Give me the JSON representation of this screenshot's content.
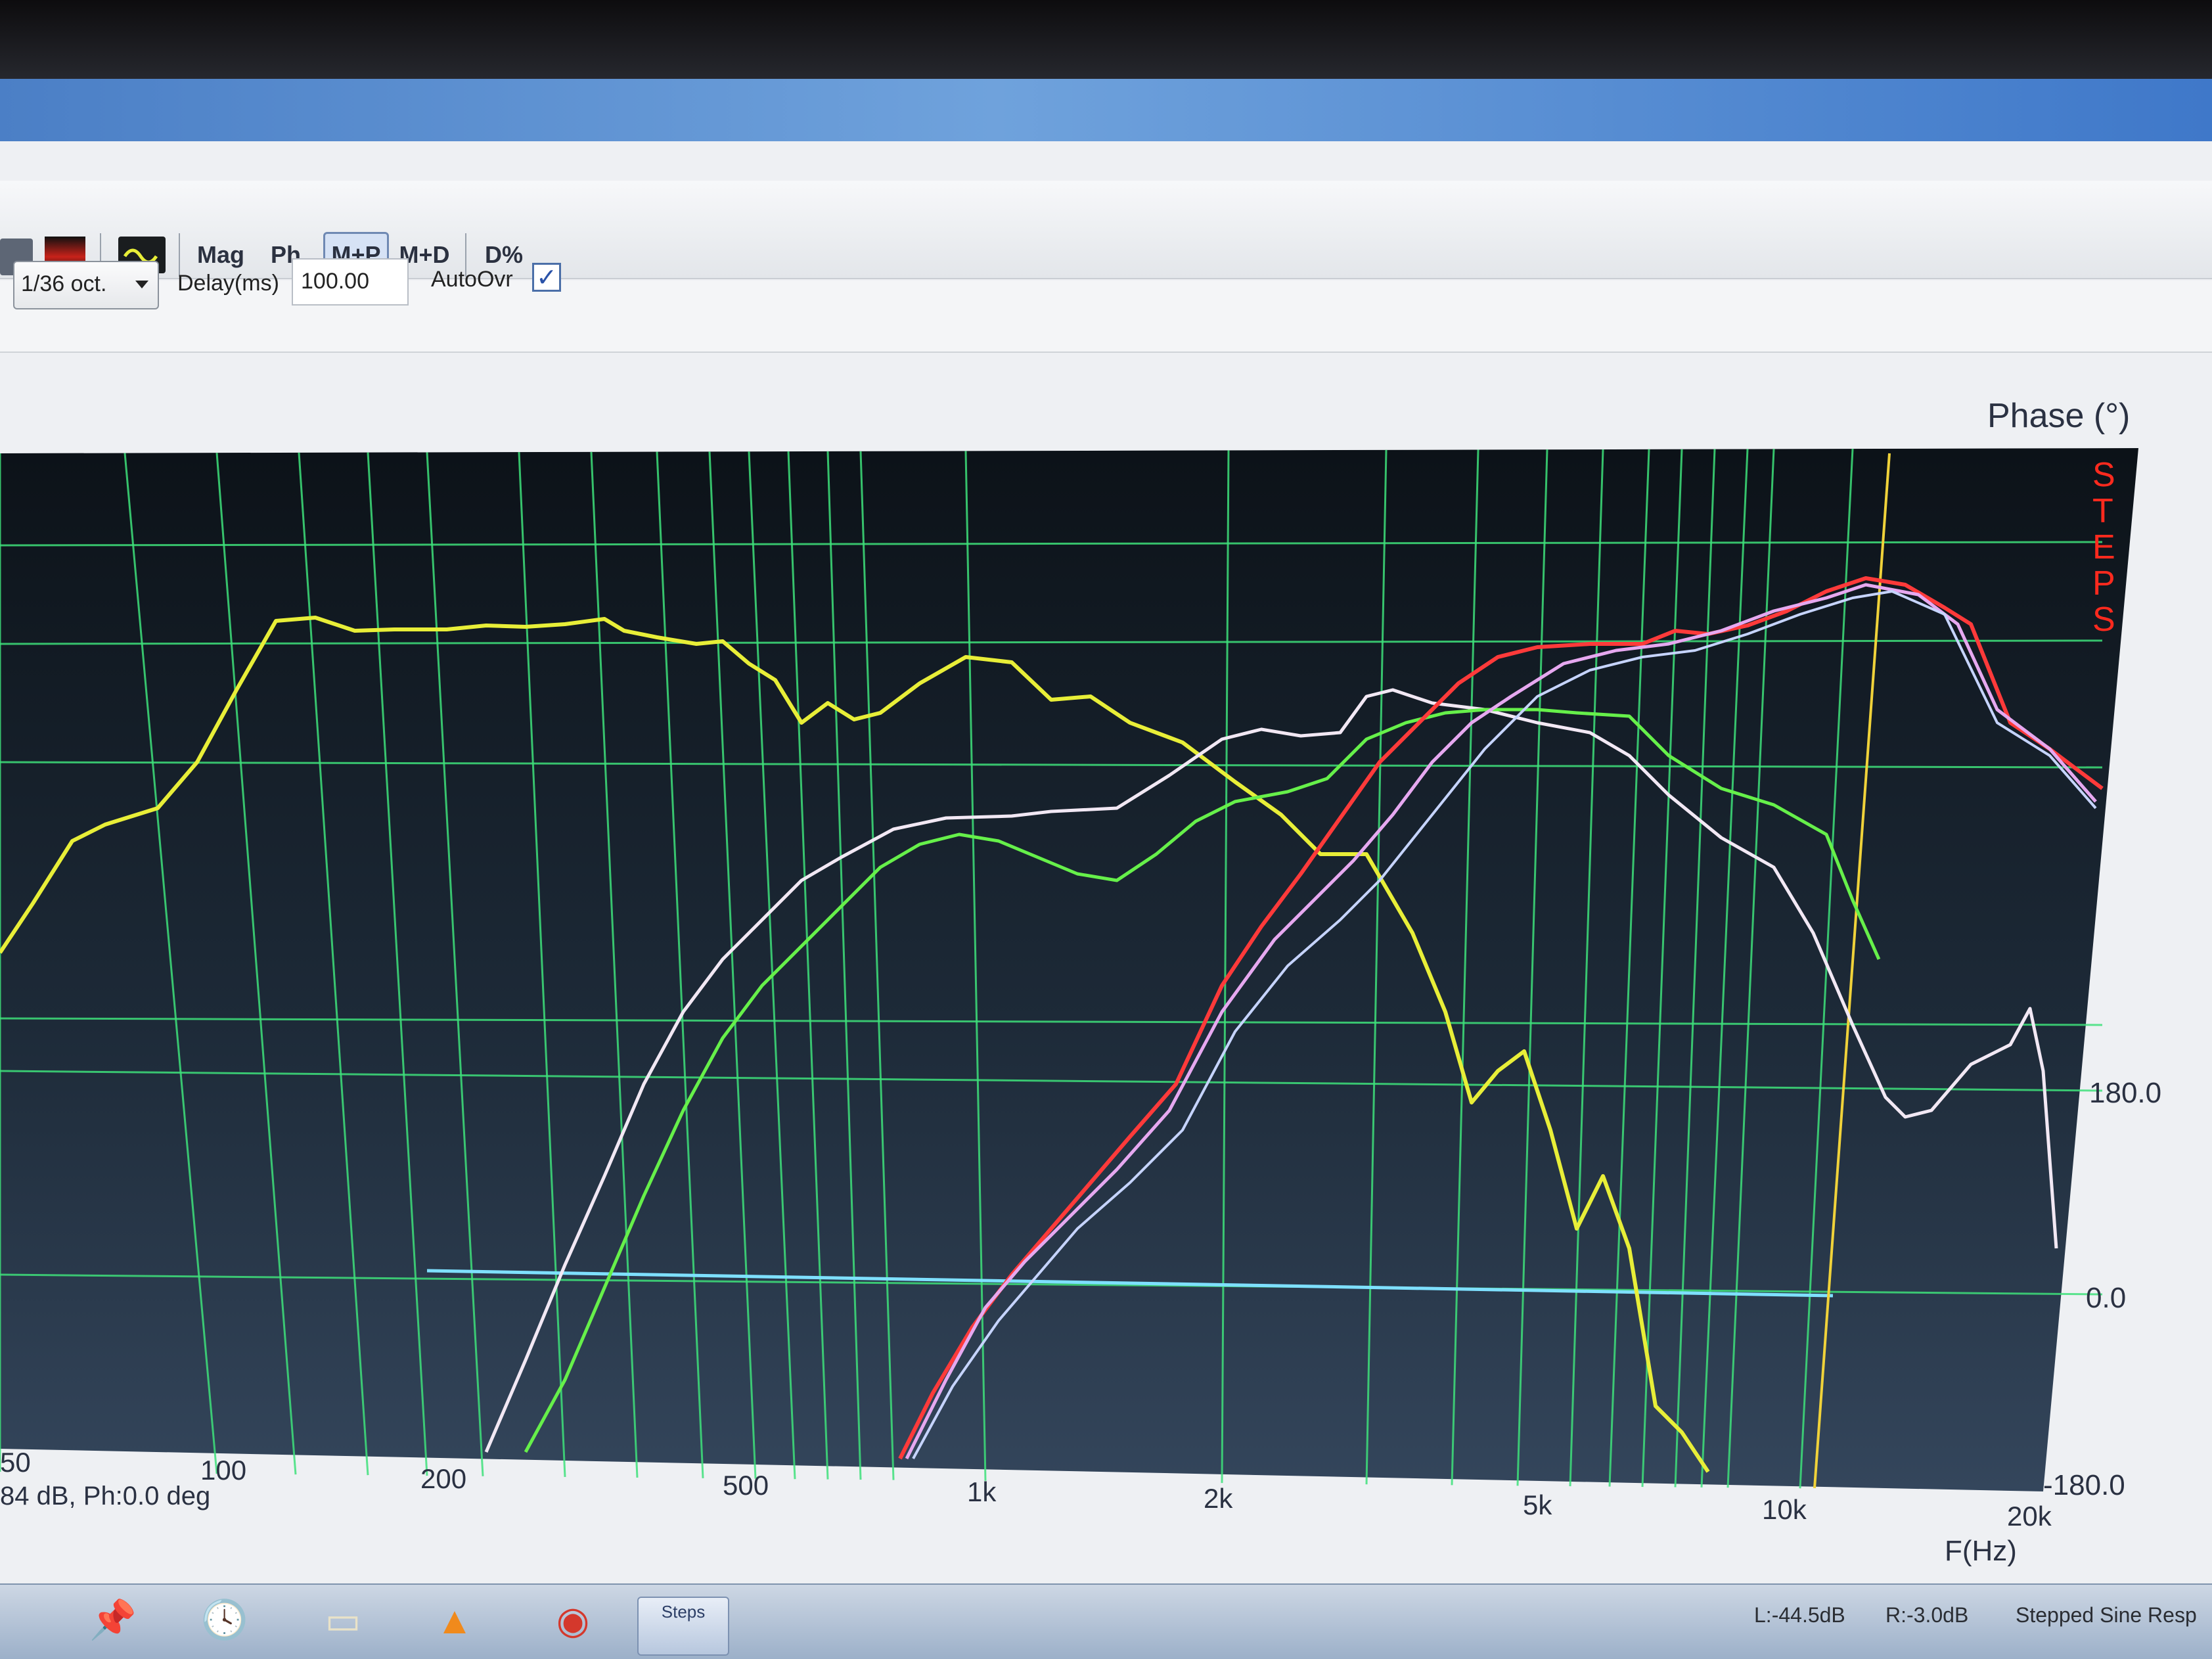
{
  "toolbar": {
    "mag_label": "Mag",
    "ph_label": "Ph",
    "mp_label": "M+P",
    "md_label": "M+D",
    "dpct_label": "D%"
  },
  "options": {
    "octave_value": "1/36 oct.",
    "delay_label": "Delay(ms)",
    "delay_value": "100.00",
    "autoovr_label": "AutoOvr",
    "autoovr_checked": "✓"
  },
  "graph": {
    "phase_axis_title": "Phase (°)",
    "freq_axis_title": "F(Hz)",
    "brand_letters": [
      "S",
      "T",
      "E",
      "P",
      "S"
    ],
    "phase_ticks": [
      "180.0",
      "0.0",
      "-180.0"
    ],
    "freq_ticks": [
      "50",
      "100",
      "200",
      "500",
      "1k",
      "2k",
      "5k",
      "10k",
      "20k"
    ],
    "cursor_readout": "84 dB, Ph:0.0 deg"
  },
  "status": {
    "left_level": "L:-44.5dB",
    "right_level": "R:-3.0dB",
    "mode": "Stepped Sine Resp"
  },
  "taskbar": {
    "steps_label": "Steps"
  },
  "colors": {
    "plot_bg_top": "#0c1218",
    "plot_bg_bottom": "#2f4055",
    "grid": "#3ee07a",
    "yellow_trace": "#e8ee38",
    "white_trace": "#f2e8f4",
    "green_trace": "#66f04a",
    "red_trace": "#ff3a3a",
    "pink_trace": "#e6a8f0",
    "blue_trace": "#c6d4ff",
    "zero_line": "#7ee0ff",
    "cursor": "#f0d23a"
  }
}
